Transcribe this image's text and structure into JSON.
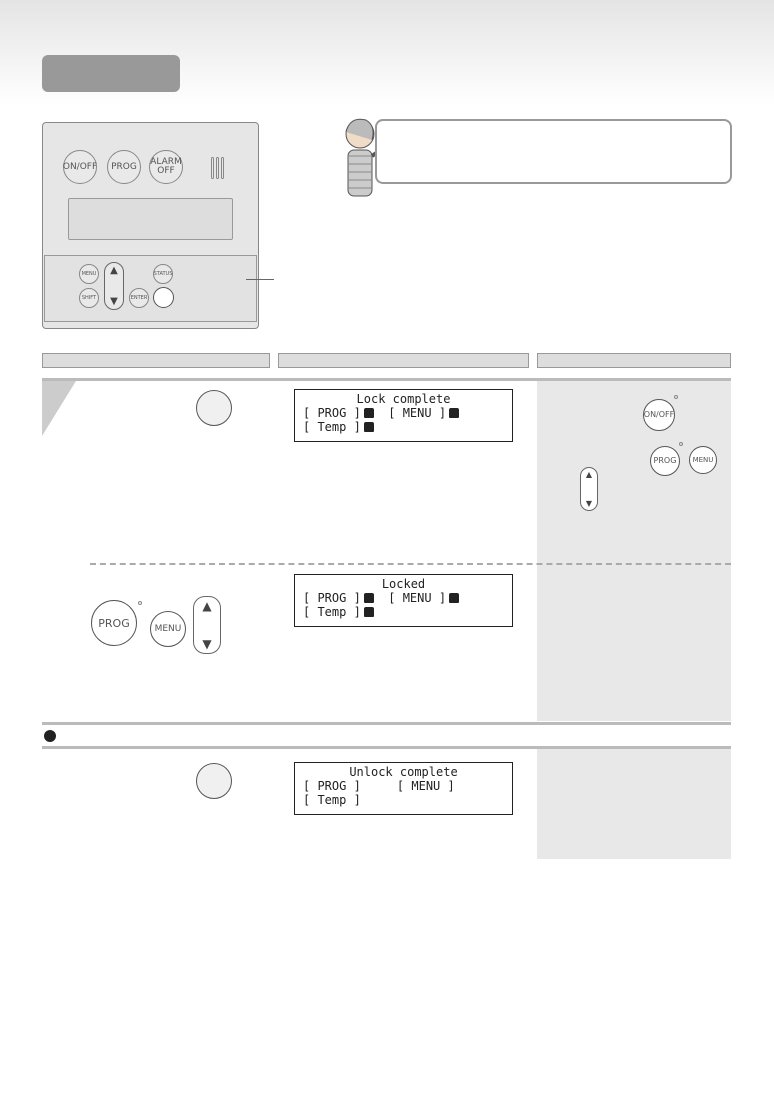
{
  "controller": {
    "buttons": {
      "on_off": "ON/OFF",
      "prog": "PROG",
      "alarm_off": "ALARM OFF",
      "menu": "MENU",
      "shift": "SHIFT",
      "status": "STATUS",
      "enter": "ENTER",
      "up": "▲",
      "down": "▼"
    }
  },
  "steps": {
    "lock_display": {
      "title": "Lock complete",
      "row1_left": "[  PROG   ]",
      "row1_right": "[ MENU ]",
      "row2": "[  Temp   ]"
    },
    "locked_display": {
      "title": "Locked",
      "row1_left": "[  PROG   ]",
      "row1_right": "[ MENU ]",
      "row2": "[  Temp   ]"
    },
    "unlock_display": {
      "title": "Unlock complete",
      "row1_left": "[  PROG   ]",
      "row1_right": "[ MENU ]",
      "row2": "[  Temp   ]"
    }
  },
  "buttons": {
    "prog": "PROG",
    "menu": "MENU",
    "on_off": "ON/OFF",
    "up": "▲",
    "down": "▼"
  }
}
